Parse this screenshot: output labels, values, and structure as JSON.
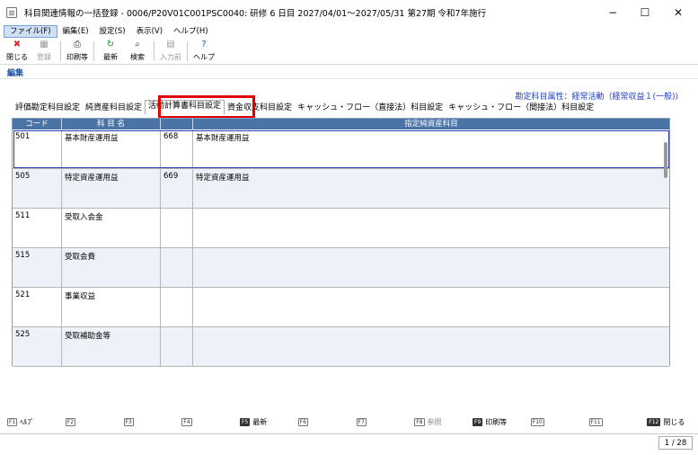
{
  "window": {
    "title": "科目関連情報の一括登録 - 0006/P20V01C001PSC0040: 研修 6 日目 2027/04/01～2027/05/31 第27期 令和7年施行",
    "controls": {
      "minimize": "−",
      "maximize": "☐",
      "close": "✕"
    }
  },
  "menu": [
    {
      "label": "ファイル(F)",
      "active": true
    },
    {
      "label": "編集(E)"
    },
    {
      "label": "設定(S)"
    },
    {
      "label": "表示(V)"
    },
    {
      "label": "ヘルプ(H)"
    }
  ],
  "toolbar": [
    {
      "label": "閉じる",
      "icon": "close-icon",
      "glyph": "✖",
      "color": "#d92b2b",
      "enabled": true
    },
    {
      "label": "登録",
      "icon": "register-icon",
      "glyph": "▦",
      "color": "#9a9a9a",
      "enabled": false
    },
    {
      "label": "印刷等",
      "icon": "printer-icon",
      "glyph": "⎙",
      "color": "#333333",
      "enabled": true
    },
    {
      "label": "最新",
      "icon": "refresh-icon",
      "glyph": "↻",
      "color": "#2e9a2e",
      "enabled": true
    },
    {
      "label": "検索",
      "icon": "search-icon",
      "glyph": "⌕",
      "color": "#333333",
      "enabled": true
    },
    {
      "label": "入力前",
      "icon": "undo-icon",
      "glyph": "▤",
      "color": "#9a9a9a",
      "enabled": false
    },
    {
      "label": "ヘルプ",
      "icon": "help-icon",
      "glyph": "?",
      "color": "#1e5fc4",
      "enabled": true
    }
  ],
  "mode_label": "編集",
  "attribute_line": "勘定科目属性：経常活動（経常収益１(一般))",
  "tabs": [
    {
      "label": "評価勘定科目設定"
    },
    {
      "label": "純資産科目設定"
    },
    {
      "label": "活動計算書科目設定",
      "active": true
    },
    {
      "label": "資金収支科目設定"
    },
    {
      "label": "キャッシュ・フロー（直接法）科目設定"
    },
    {
      "label": "キャッシュ・フロー（間接法）科目設定"
    }
  ],
  "grid": {
    "headers": {
      "code": "コード",
      "name": "科 目 名",
      "specified": "指定純資産科目"
    },
    "rows": [
      {
        "code": "501",
        "name": "基本財産運用益",
        "spec_code": "668",
        "spec_name": "基本財産運用益",
        "selected": true
      },
      {
        "code": "505",
        "name": "特定資産運用益",
        "spec_code": "669",
        "spec_name": "特定資産運用益"
      },
      {
        "code": "511",
        "name": "受取入会金",
        "spec_code": "",
        "spec_name": ""
      },
      {
        "code": "515",
        "name": "受取会費",
        "spec_code": "",
        "spec_name": ""
      },
      {
        "code": "521",
        "name": "事業収益",
        "spec_code": "",
        "spec_name": ""
      },
      {
        "code": "525",
        "name": "受取補助金等",
        "spec_code": "",
        "spec_name": ""
      }
    ]
  },
  "fkeys": [
    {
      "key": "F1",
      "label": "ﾍﾙﾌﾟ",
      "style": "normal"
    },
    {
      "key": "F2",
      "label": "",
      "style": "dim"
    },
    {
      "key": "F3",
      "label": "",
      "style": "dim"
    },
    {
      "key": "F4",
      "label": "",
      "style": "dim"
    },
    {
      "key": "F5",
      "label": "最新",
      "style": "bold"
    },
    {
      "key": "F6",
      "label": "",
      "style": "dim"
    },
    {
      "key": "F7",
      "label": "",
      "style": "dim"
    },
    {
      "key": "F8",
      "label": "参照",
      "style": "dim"
    },
    {
      "key": "F9",
      "label": "印刷等",
      "style": "bold"
    },
    {
      "key": "F10",
      "label": "",
      "style": "dim"
    },
    {
      "key": "F11",
      "label": "",
      "style": "dim"
    },
    {
      "key": "F12",
      "label": "閉じる",
      "style": "bold"
    }
  ],
  "page_indicator": "1 / 28"
}
